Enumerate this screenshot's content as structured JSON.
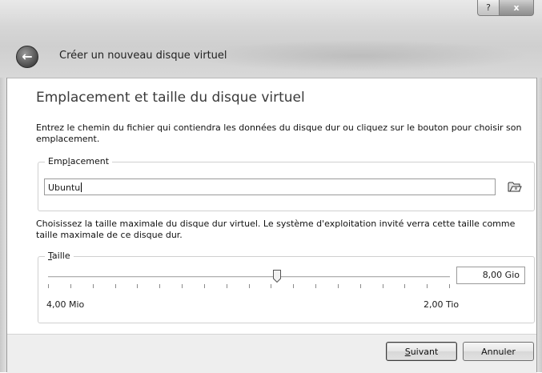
{
  "window": {
    "help_label": "?",
    "close_label": "x"
  },
  "header": {
    "back_icon": "arrow-left-icon",
    "title": "Créer un nouveau disque virtuel"
  },
  "page": {
    "heading": "Emplacement et taille du disque virtuel",
    "location_description": "Entrez le chemin du fichier qui contiendra les données du disque dur ou cliquez sur le bouton pour choisir son emplacement.",
    "size_description": "Choisissez la taille maximale du disque dur virtuel. Le système d'exploitation invité verra cette taille comme taille maximale de ce disque dur."
  },
  "location": {
    "legend": "Emplacement",
    "legend_mnemonic": "l",
    "value": "Ubuntu",
    "browse_icon": "folder-open-icon"
  },
  "size": {
    "legend": "Taille",
    "value": "8,00 Gio",
    "min_label": "4,00 Mio",
    "max_label": "2,00 Tio",
    "slider_position": 0.57,
    "tick_count": 19
  },
  "footer": {
    "next_label": "Suivant",
    "cancel_label": "Annuler"
  }
}
